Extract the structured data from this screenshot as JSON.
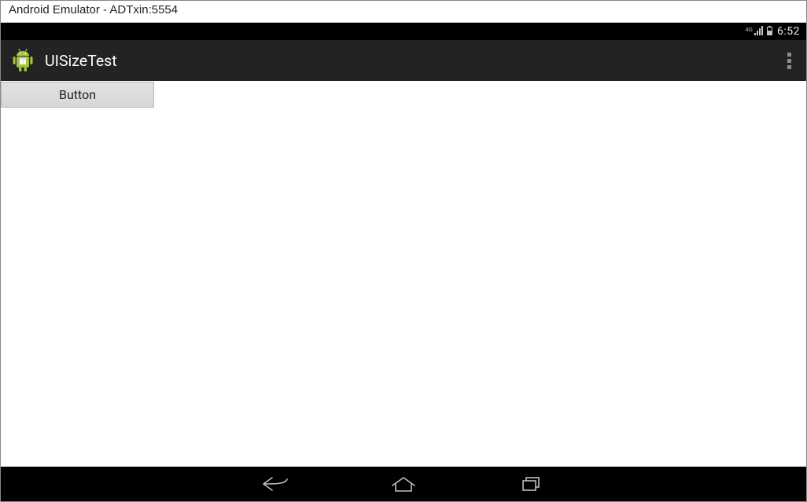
{
  "window": {
    "title": "Android Emulator - ADTxin:5554"
  },
  "status_bar": {
    "network_type": "4G",
    "signal_icon": "signal-bars-icon",
    "battery_icon": "battery-icon",
    "clock": "6:52"
  },
  "action_bar": {
    "app_icon": "android-robot-icon",
    "title": "UISizeTest",
    "overflow_icon": "overflow-menu-icon"
  },
  "content": {
    "button_label": "Button"
  },
  "nav_bar": {
    "back_icon": "back-icon",
    "home_icon": "home-icon",
    "recents_icon": "recents-icon"
  }
}
